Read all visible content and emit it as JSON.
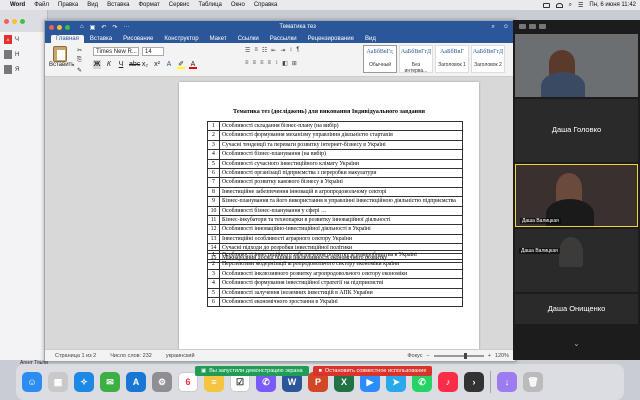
{
  "menubar": {
    "app": "Word",
    "items": [
      "Файл",
      "Правка",
      "Вид",
      "Вставка",
      "Формат",
      "Сервис",
      "Таблица",
      "Окно",
      "Справка"
    ],
    "clock": "Пн, 6 июня  11:42"
  },
  "window": {
    "title": "Тематика тез"
  },
  "ribbon": {
    "tabs": [
      "Главная",
      "Вставка",
      "Рисование",
      "Конструктор",
      "Макет",
      "Ссылки",
      "Рассылки",
      "Рецензирование",
      "Вид"
    ],
    "active_tab": "Главная",
    "paste_label": "Вставить",
    "font_name": "Times New R...",
    "font_size": "14",
    "styles": [
      {
        "sample": "АаБбВвГг,",
        "label": "Обычный"
      },
      {
        "sample": "АаБбВвГгД",
        "label": "Без интерва..."
      },
      {
        "sample": "АаБбВвГ",
        "label": "Заголовок 1"
      },
      {
        "sample": "АаБбВвГгД",
        "label": "Заголовок 2"
      }
    ]
  },
  "document": {
    "title": "Тематика тез (досліджень) для виконання Індивідуального завдання",
    "table1": [
      {
        "n": "1",
        "text": "Особливості складання бізнес-плану (на вибір)"
      },
      {
        "n": "2",
        "text": "Особливості формування механізму управління діяльністю стартапів"
      },
      {
        "n": "3",
        "text": "Сучасні тенденції та переваги розвитку інтернет-бізнесу в Україні"
      },
      {
        "n": "4",
        "text": "Особливості бізнес-планування (на вибір)"
      },
      {
        "n": "5",
        "text": "Особливості сучасного інвестиційного клімату України"
      },
      {
        "n": "6",
        "text": "Особливості організації підприємства з переробки макулатури"
      },
      {
        "n": "7",
        "text": "Особливості розвитку кавового бізнесу в Україні"
      },
      {
        "n": "8",
        "text": "Інвестиційне забезпечення інновацій в агропродовольчому секторі"
      },
      {
        "n": "9",
        "text": "Бізнес-планування та його використання в управлінні інвестиційною діяльністю підприємства"
      },
      {
        "n": "10",
        "text": "Особливості бізнес-планування у сфері …"
      },
      {
        "n": "11",
        "text": "Бізнес-інкубатори та технопарки в розвитку інноваційної діяльності"
      },
      {
        "n": "12",
        "text": "Особливості інноваційно-інвестиційної діяльності в Україні"
      },
      {
        "n": "13",
        "text": "Інвестиційні особливості аграрного сектору України"
      },
      {
        "n": "14",
        "text": "Сучасні підходи до розробки інвестиційної політики"
      },
      {
        "n": "15",
        "text": "Міжнародний досвід оцінки інклюзивності економічного розвитку"
      }
    ],
    "table2": [
      {
        "n": "1",
        "text": "Особливості інвестиційного забезпечення розвитку агровиробництва в Україні"
      },
      {
        "n": "2",
        "text": "Перспективи модернізації агропродовольчого сектору економіки країни"
      },
      {
        "n": "3",
        "text": "Особливості інклюзивного розвитку агропродовольчого сектору економіки"
      },
      {
        "n": "4",
        "text": "Особливості формування інвестиційної стратегії на підприємстві"
      },
      {
        "n": "5",
        "text": "Особливості залучення іноземних інвестицій в АПК України"
      },
      {
        "n": "6",
        "text": "Особливості економічного зростання в Україні"
      }
    ]
  },
  "statusbar": {
    "page": "Страница 1 из 2",
    "words": "Число слов: 232",
    "language": "украинский",
    "focus": "Фокус",
    "zoom": "120%"
  },
  "zoom": {
    "participants": [
      {
        "name": "",
        "label": ""
      },
      {
        "name": "Даша Головко",
        "label": ""
      },
      {
        "name": "",
        "label": "Даша Валицкая"
      },
      {
        "name": "Даша Онищенко",
        "label": "Даша Валицкая"
      }
    ]
  },
  "sidebar_browser": {
    "items": [
      "Ч",
      "Н",
      "Я"
    ]
  },
  "share": {
    "status": "Вы запустили демонстрацию экрана",
    "stop": "Остановить совместное использование"
  },
  "dock": {
    "label": "Агент Тяьпи"
  },
  "colors": {
    "word_blue": "#2b579a",
    "share_green": "#1f9d55",
    "stop_red": "#d9342b"
  }
}
